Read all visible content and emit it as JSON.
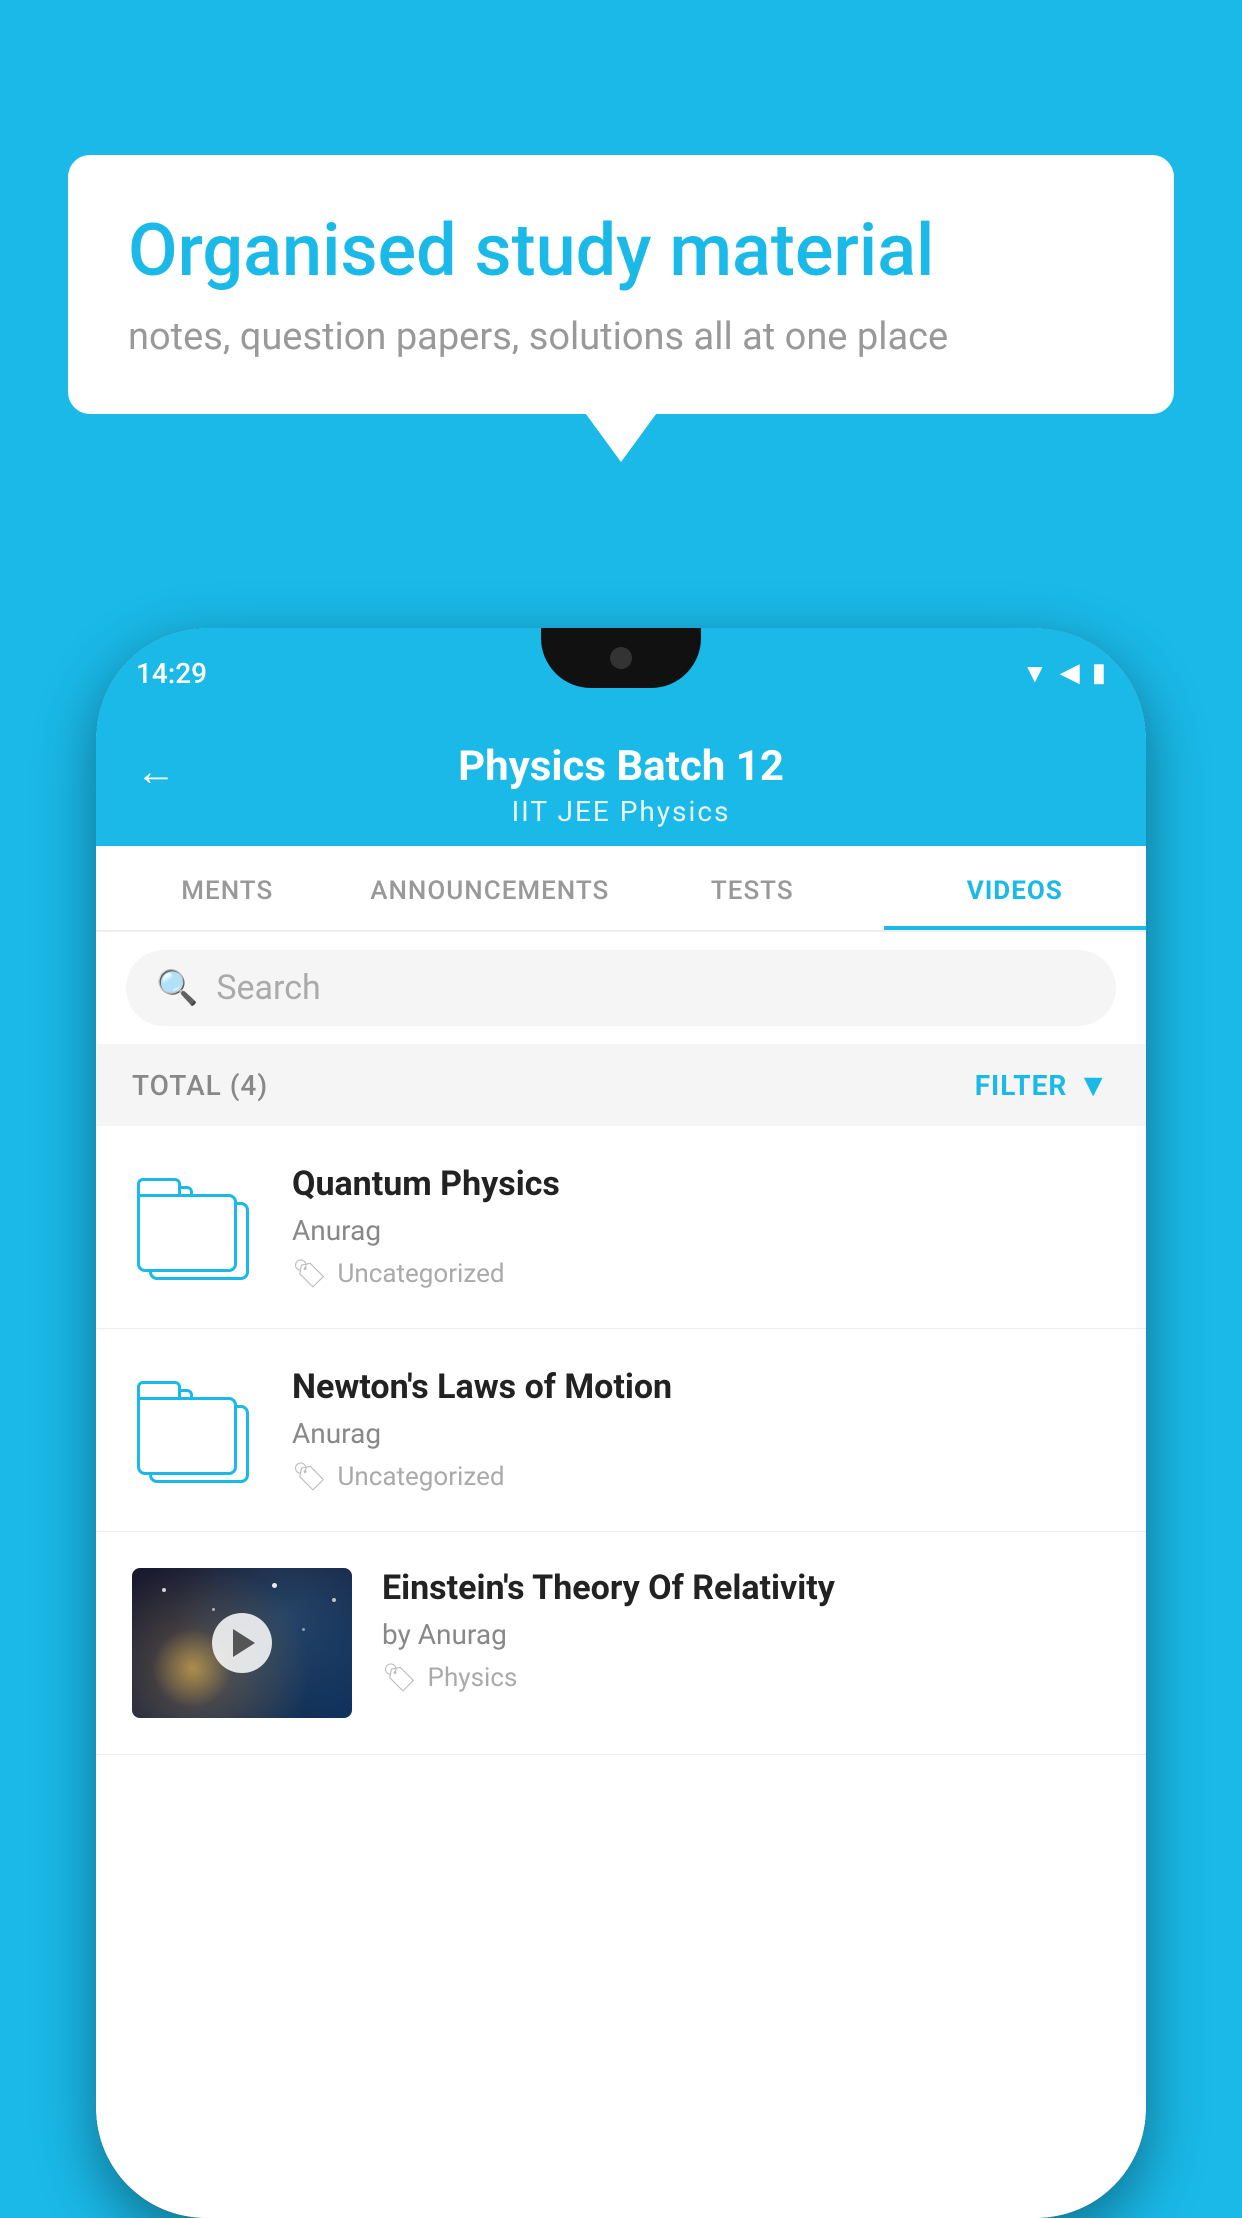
{
  "background": {
    "color": "#1ab9e8"
  },
  "speech_bubble": {
    "title": "Organised study material",
    "subtitle": "notes, question papers, solutions all at one place"
  },
  "phone": {
    "status_bar": {
      "time": "14:29"
    },
    "header": {
      "title": "Physics Batch 12",
      "subtitle": "IIT JEE   Physics",
      "back_label": "←"
    },
    "tabs": [
      {
        "label": "MENTS",
        "active": false
      },
      {
        "label": "ANNOUNCEMENTS",
        "active": false
      },
      {
        "label": "TESTS",
        "active": false
      },
      {
        "label": "VIDEOS",
        "active": true
      }
    ],
    "search": {
      "placeholder": "Search"
    },
    "filter_bar": {
      "total_label": "TOTAL (4)",
      "filter_label": "FILTER"
    },
    "videos": [
      {
        "title": "Quantum Physics",
        "author": "Anurag",
        "tag": "Uncategorized",
        "has_thumbnail": false
      },
      {
        "title": "Newton's Laws of Motion",
        "author": "Anurag",
        "tag": "Uncategorized",
        "has_thumbnail": false
      },
      {
        "title": "Einstein's Theory Of Relativity",
        "author": "by Anurag",
        "tag": "Physics",
        "has_thumbnail": true
      }
    ]
  }
}
